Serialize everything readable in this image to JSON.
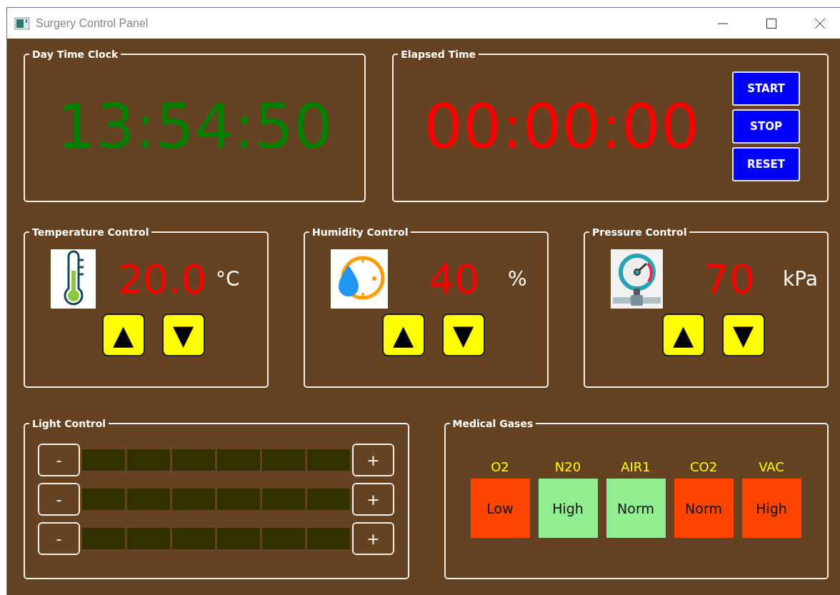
{
  "window": {
    "title": "Surgery Control Panel"
  },
  "day_clock": {
    "title": "Day Time Clock",
    "time": "13:54:50"
  },
  "elapsed": {
    "title": "Elapsed Time",
    "time": "00:00:00",
    "buttons": [
      "START",
      "STOP",
      "RESET"
    ]
  },
  "controls": [
    {
      "kind": "thermometer",
      "title": "Temperature Control",
      "value": "20.0",
      "unit": "°C",
      "up": "▲",
      "down": "▼"
    },
    {
      "kind": "humidity",
      "title": "Humidity Control",
      "value": "40",
      "unit": "%",
      "up": "▲",
      "down": "▼"
    },
    {
      "kind": "gauge",
      "title": "Pressure Control",
      "value": "70",
      "unit": "kPa",
      "up": "▲",
      "down": "▼"
    }
  ],
  "light_control": {
    "title": "Light Control",
    "rows": [
      {
        "minus": "-",
        "plus": "+"
      },
      {
        "minus": "-",
        "plus": "+"
      },
      {
        "minus": "-",
        "plus": "+"
      }
    ]
  },
  "medical_gases": {
    "title": "Medical Gases",
    "gases": [
      {
        "name": "O2",
        "status": "Low",
        "color": "#ff4500"
      },
      {
        "name": "N20",
        "status": "High",
        "color": "#90ee90"
      },
      {
        "name": "AIR1",
        "status": "Norm",
        "color": "#90ee90"
      },
      {
        "name": "CO2",
        "status": "Norm",
        "color": "#ff4500"
      },
      {
        "name": "VAC",
        "status": "High",
        "color": "#ff4500"
      }
    ]
  }
}
